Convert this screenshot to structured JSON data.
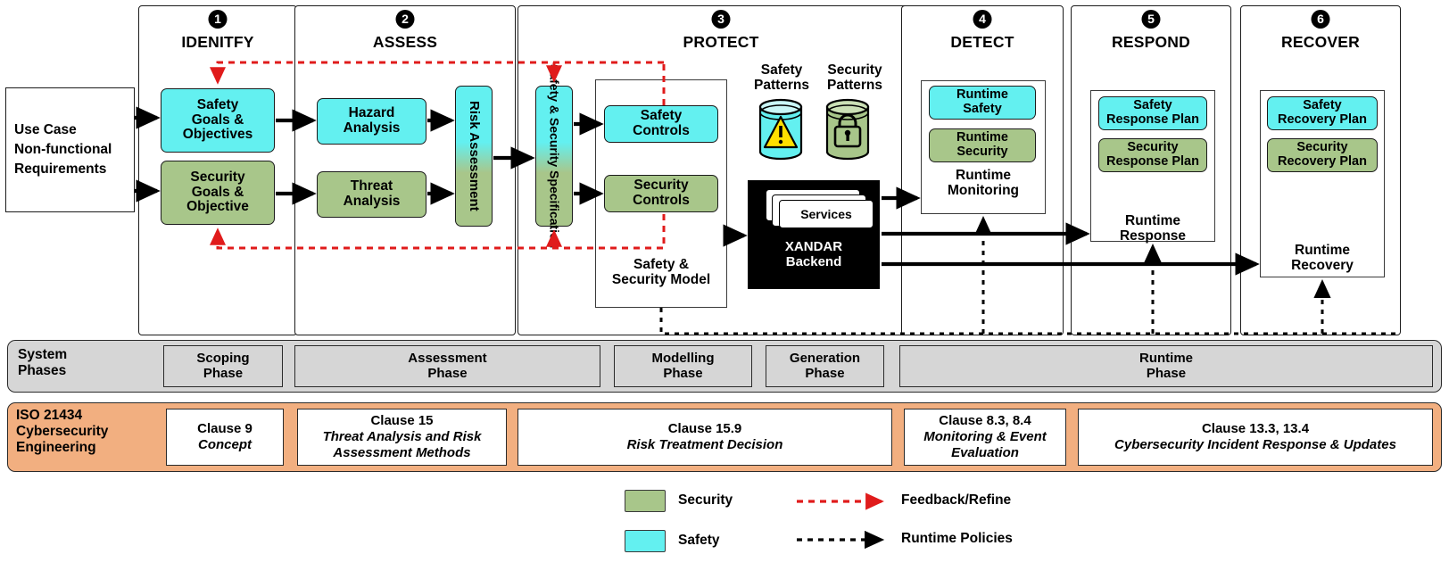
{
  "columns": [
    {
      "num": "1",
      "title": "IDENITFY"
    },
    {
      "num": "2",
      "title": "ASSESS"
    },
    {
      "num": "3",
      "title": "PROTECT"
    },
    {
      "num": "4",
      "title": "DETECT"
    },
    {
      "num": "5",
      "title": "RESPOND"
    },
    {
      "num": "6",
      "title": "RECOVER"
    }
  ],
  "input": {
    "text": "Use Case\nNon-functional\nRequirements"
  },
  "identify": {
    "safety": "Safety\nGoals &\nObjectives",
    "security": "Security\nGoals &\nObjective"
  },
  "assess": {
    "hazard": "Hazard\nAnalysis",
    "threat": "Threat\nAnalysis",
    "risk": "Risk Assessment"
  },
  "protect": {
    "spec": "Safety & Security Specification",
    "safety_controls": "Safety\nControls",
    "security_controls": "Security\nControls",
    "model_label": "Safety &\nSecurity Model",
    "safety_patterns": "Safety\nPatterns",
    "security_patterns": "Security\nPatterns",
    "services": "Services",
    "backend": "XANDAR\nBackend"
  },
  "detect": {
    "runtime_safety": "Runtime\nSafety",
    "runtime_security": "Runtime\nSecurity",
    "caption": "Runtime\nMonitoring"
  },
  "respond": {
    "safety_plan": "Safety\nResponse Plan",
    "security_plan": "Security\nResponse Plan",
    "caption": "Runtime\nResponse"
  },
  "recover": {
    "safety_plan": "Safety\nRecovery Plan",
    "security_plan": "Security\nRecovery Plan",
    "caption": "Runtime\nRecovery"
  },
  "system_phases": {
    "label": "System\nPhases",
    "items": [
      {
        "name": "Scoping\nPhase"
      },
      {
        "name": "Assessment\nPhase"
      },
      {
        "name": "Modelling\nPhase"
      },
      {
        "name": "Generation\nPhase"
      },
      {
        "name": "Runtime\nPhase"
      }
    ]
  },
  "iso": {
    "label": "ISO 21434\nCybersecurity\nEngineering",
    "items": [
      {
        "clause": "Clause 9",
        "title": "Concept"
      },
      {
        "clause": "Clause 15",
        "title": "Threat Analysis and Risk Assessment Methods"
      },
      {
        "clause": "Clause 15.9",
        "title": "Risk Treatment Decision"
      },
      {
        "clause": "Clause 8.3, 8.4",
        "title": "Monitoring & Event Evaluation"
      },
      {
        "clause": "Clause 13.3, 13.4",
        "title": "Cybersecurity Incident Response & Updates"
      }
    ]
  },
  "legend": {
    "security": "Security",
    "safety": "Safety",
    "feedback": "Feedback/Refine",
    "runtime_policies": "Runtime Policies"
  },
  "colors": {
    "safety": "#63F0F0",
    "security": "#A8C68A",
    "feedback_arrow": "#E01B1B",
    "runtime_arrow": "#000000",
    "iso_band": "#F2AF80",
    "system_band": "#D6D6D6",
    "backend": "#000000",
    "warning": "#FFE000"
  }
}
